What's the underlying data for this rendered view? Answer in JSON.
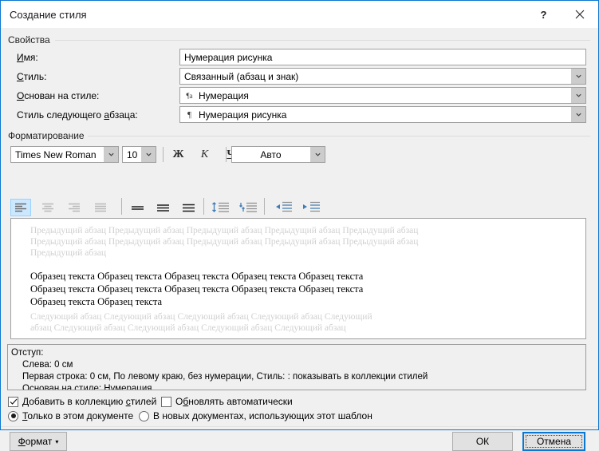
{
  "window": {
    "title": "Создание стиля",
    "help_icon": "help-question-icon",
    "close_icon": "close-icon"
  },
  "properties": {
    "group_label": "Свойства",
    "name": {
      "label": "Имя:",
      "label_accel": "И",
      "value": "Нумерация рисунка"
    },
    "style_type": {
      "label": "Стиль:",
      "label_accel": "С",
      "value": "Связанный (абзац и знак)"
    },
    "based_on": {
      "label": "Основан на стиле:",
      "label_accel": "О",
      "value": "Нумерация",
      "icon": "linked-paragraph-char-style-icon",
      "icon_glyph": "¶a"
    },
    "next_style": {
      "label": "Стиль следующего абзаца:",
      "label_accel": "а",
      "value": "Нумерация рисунка",
      "icon": "paragraph-style-icon",
      "icon_glyph": "¶"
    }
  },
  "formatting": {
    "group_label": "Форматирование",
    "font_family": "Times New Roman",
    "font_size": "10",
    "bold_label": "Ж",
    "italic_label": "К",
    "underline_label": "Ч",
    "font_color": "Авто",
    "align_buttons": [
      {
        "name": "align-left-button",
        "selected": true
      },
      {
        "name": "align-center-button",
        "selected": false
      },
      {
        "name": "align-right-button",
        "selected": false
      },
      {
        "name": "align-justify-button",
        "selected": false
      }
    ],
    "line_spacing_buttons": [
      {
        "name": "line-spacing-single-button"
      },
      {
        "name": "line-spacing-1-5-button"
      },
      {
        "name": "line-spacing-double-button"
      }
    ],
    "paragraph_spacing_buttons": [
      {
        "name": "increase-paragraph-spacing-button"
      },
      {
        "name": "decrease-paragraph-spacing-button"
      }
    ],
    "indent_buttons": [
      {
        "name": "decrease-indent-button"
      },
      {
        "name": "increase-indent-button"
      }
    ]
  },
  "preview": {
    "previous_paragraph_line1": "Предыдущий абзац Предыдущий абзац Предыдущий абзац Предыдущий абзац Предыдущий абзац",
    "previous_paragraph_line2": "Предыдущий абзац Предыдущий абзац Предыдущий абзац Предыдущий абзац Предыдущий абзац",
    "previous_paragraph_line3": "Предыдущий абзац",
    "sample_line1": "Образец текста Образец текста Образец текста Образец текста Образец текста",
    "sample_line2": "Образец текста Образец текста Образец текста Образец текста Образец текста",
    "sample_line3": "Образец текста Образец текста",
    "next_paragraph_line1": "Следующий абзац Следующий абзац Следующий абзац Следующий абзац Следующий",
    "next_paragraph_line2": "абзац Следующий абзац Следующий абзац Следующий абзац Следующий абзац"
  },
  "description": {
    "line1": "Отступ:",
    "line2": "Слева:  0 см",
    "line3": "Первая строка:  0 см, По левому краю,  без нумерации, Стиль: : показывать в коллекции стилей",
    "line4": "Основан на стиле: Нумерация"
  },
  "options": {
    "add_to_gallery": {
      "label": "Добавить в коллекцию стилей",
      "checked": true
    },
    "auto_update": {
      "label": "Обновлять автоматически",
      "checked": false
    },
    "only_this_document": {
      "label": "Только в этом документе",
      "selected": true
    },
    "new_documents_template": {
      "label": "В новых документах, использующих этот шаблон",
      "selected": false
    }
  },
  "footer": {
    "format_button": "Формат",
    "format_caret": "▾",
    "ok_button": "ОК",
    "cancel_button": "Отмена"
  },
  "colors": {
    "dialog_border": "#0a78d1",
    "titlebar_bg": "#ffffff",
    "body_bg": "#f0f0f0",
    "accent": "#0a78d1",
    "selection_bg": "#cce8ff",
    "icon_blue": "#3f7cb5"
  }
}
